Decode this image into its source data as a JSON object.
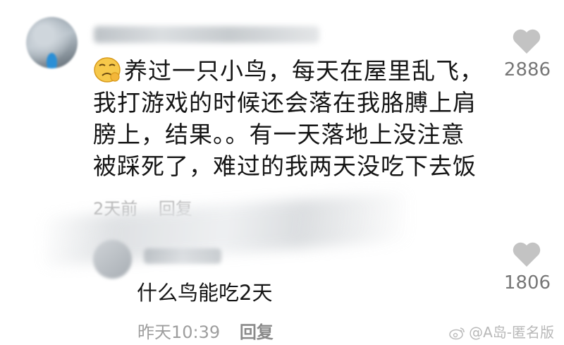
{
  "comments": [
    {
      "lines": [
        "养过一只小鸟，每天在屋里乱飞，",
        "我打游戏的时候还会落在我胳膊上肩",
        "膀上，结果。。有一天落地上没注意",
        "被踩死了，难过的我两天没吃下去饭"
      ],
      "time": "2天前",
      "reply_label": "回复",
      "likes": "2886",
      "emoji": "sad-face-emoji"
    },
    {
      "text": "什么鸟能吃2天",
      "time": "昨天10:39",
      "reply_label": "回复",
      "likes": "1806"
    }
  ],
  "watermark": "@A岛-匿名版",
  "icons": {
    "like": "heart-icon",
    "watermark_logo": "weibo-logo-icon"
  },
  "colors": {
    "text": "#151515",
    "meta": "#9e9e9e",
    "heart": "#c3c3c3"
  }
}
